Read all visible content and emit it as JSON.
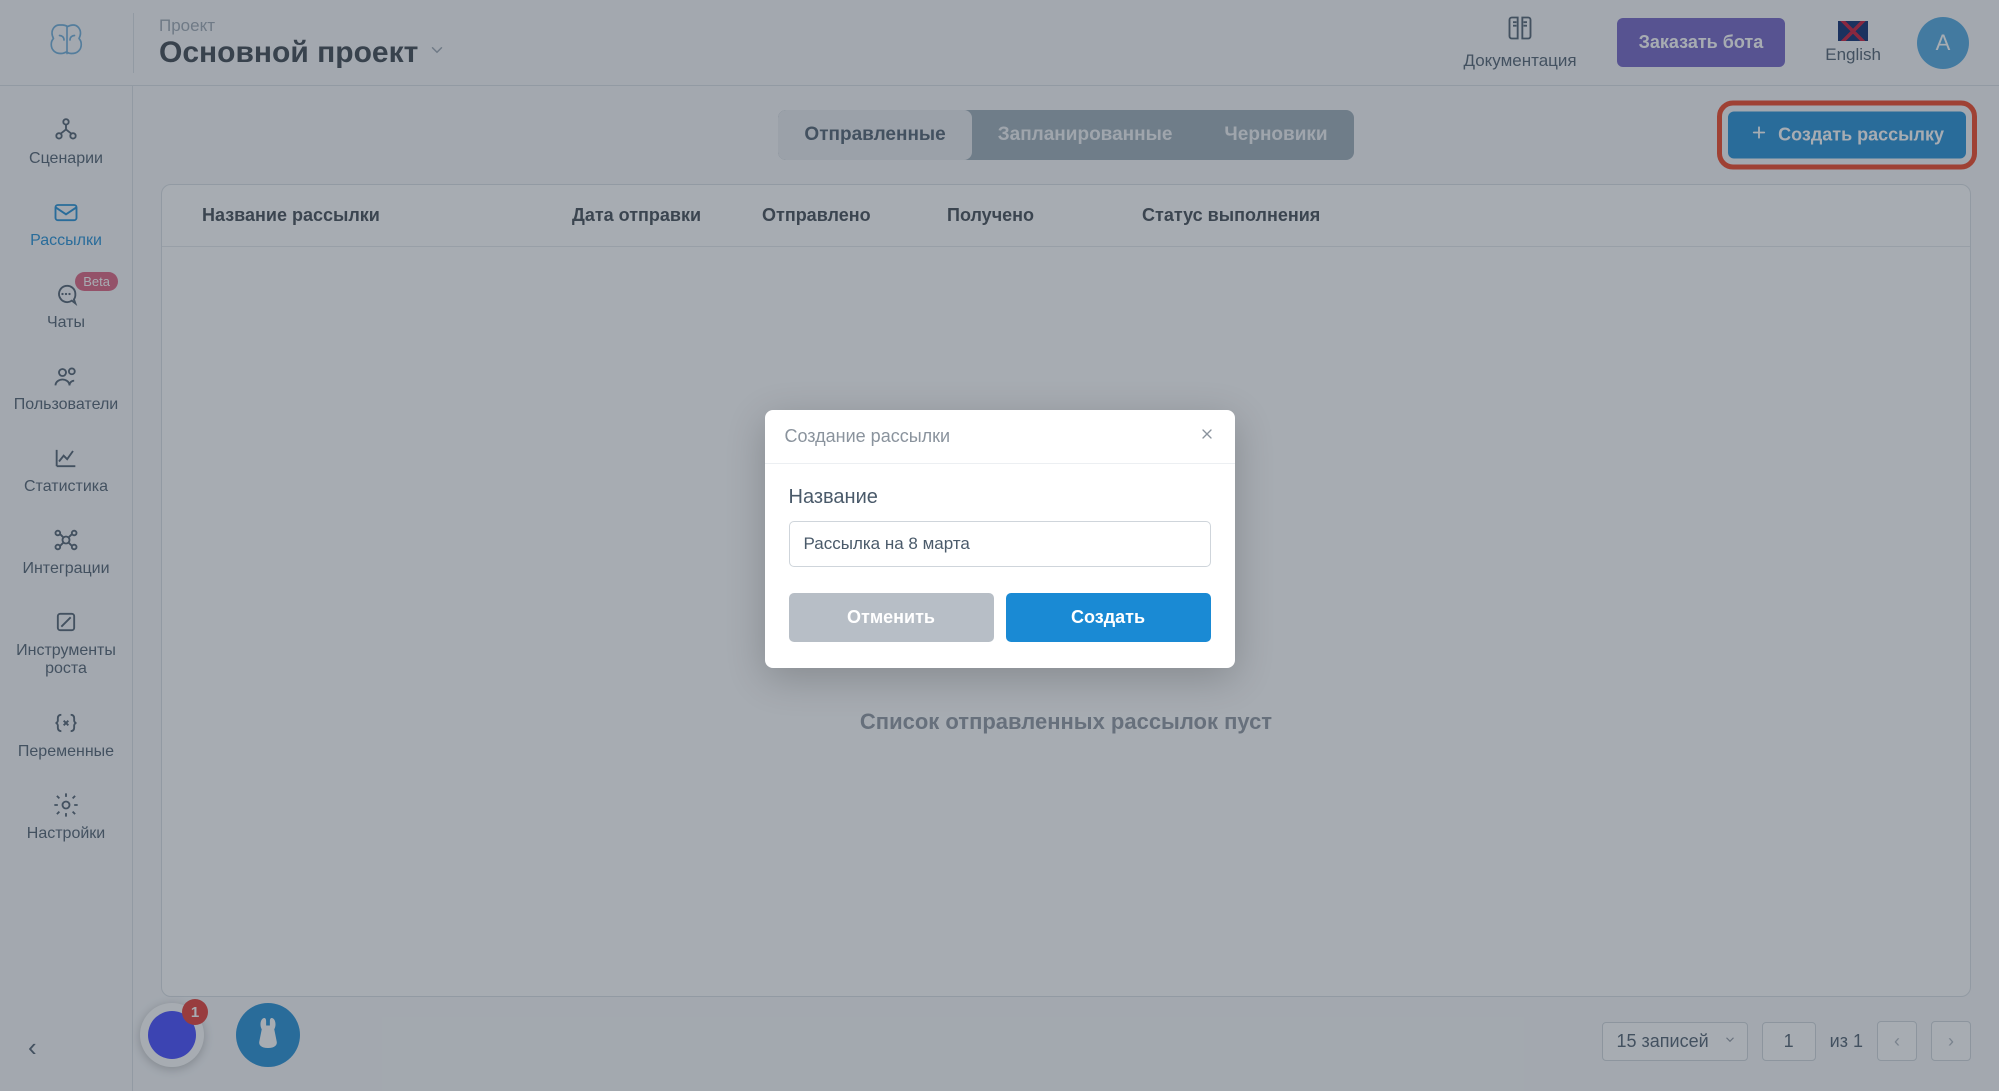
{
  "header": {
    "project_label": "Проект",
    "project_name": "Основной проект",
    "documentation": "Документация",
    "order_bot": "Заказать бота",
    "language": "English",
    "avatar_letter": "A"
  },
  "sidebar": {
    "items": [
      {
        "label": "Сценарии"
      },
      {
        "label": "Рассылки"
      },
      {
        "label": "Чаты",
        "badge": "Beta"
      },
      {
        "label": "Пользователи"
      },
      {
        "label": "Статистика"
      },
      {
        "label": "Интеграции"
      },
      {
        "label": "Инструменты роста"
      },
      {
        "label": "Переменные"
      },
      {
        "label": "Настройки"
      }
    ]
  },
  "tabs": {
    "sent": "Отправленные",
    "scheduled": "Запланированные",
    "drafts": "Черновики"
  },
  "create_button": "Создать рассылку",
  "table": {
    "headers": {
      "name": "Название рассылки",
      "send_date": "Дата отправки",
      "sent": "Отправлено",
      "received": "Получено",
      "status": "Статус выполнения"
    },
    "empty_state": "Список отправленных рассылок пуст"
  },
  "pager": {
    "per_page": "15 записей",
    "page": "1",
    "of_label": "из 1"
  },
  "modal": {
    "title": "Создание рассылки",
    "name_label": "Название",
    "name_value": "Рассылка на 8 марта",
    "cancel": "Отменить",
    "create": "Создать"
  },
  "chat_widget": {
    "badge": "1"
  }
}
